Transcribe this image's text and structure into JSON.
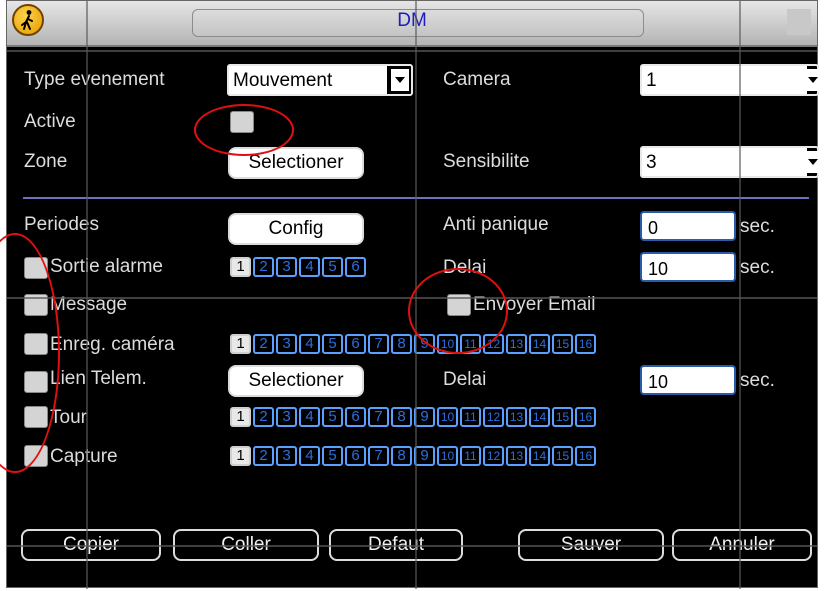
{
  "window": {
    "title": "DM"
  },
  "labels": {
    "type_evenement": "Type evenement",
    "camera": "Camera",
    "active": "Active",
    "zone": "Zone",
    "sensibilite": "Sensibilite",
    "periodes": "Periodes",
    "anti_panique": "Anti panique",
    "sortie_alarme": "Sortie alarme",
    "delai": "Delai",
    "message": "Message",
    "envoyer_email": "Envoyer Email",
    "enreg_camera": "Enreg. caméra",
    "lien_telem": "Lien Telem.",
    "delai2": "Delai",
    "tour": "Tour",
    "capture": "Capture",
    "sec": "sec."
  },
  "values": {
    "type_evenement": "Mouvement",
    "camera": "1",
    "sensibilite": "3",
    "anti_panique": "0",
    "delai": "10",
    "delai2": "10"
  },
  "buttons": {
    "zone_select": "Selectioner",
    "config": "Config",
    "lien_select": "Selectioner",
    "copier": "Copier",
    "coller": "Coller",
    "defaut": "Defaut",
    "sauver": "Sauver",
    "annuler": "Annuler"
  },
  "channels_6": [
    "1",
    "2",
    "3",
    "4",
    "5",
    "6"
  ],
  "channels_16": [
    "1",
    "2",
    "3",
    "4",
    "5",
    "6",
    "7",
    "8",
    "9",
    "10",
    "11",
    "12",
    "13",
    "14",
    "15",
    "16"
  ],
  "selected_channels": {
    "sortie_alarme": [
      "1"
    ],
    "enreg_camera": [
      "1"
    ],
    "tour": [
      "1"
    ],
    "capture": [
      "1"
    ]
  },
  "icons": {
    "logo": "person-walking-icon"
  },
  "colors": {
    "channel_active": "#2c6edc",
    "annotation_ring": "#e01010"
  }
}
